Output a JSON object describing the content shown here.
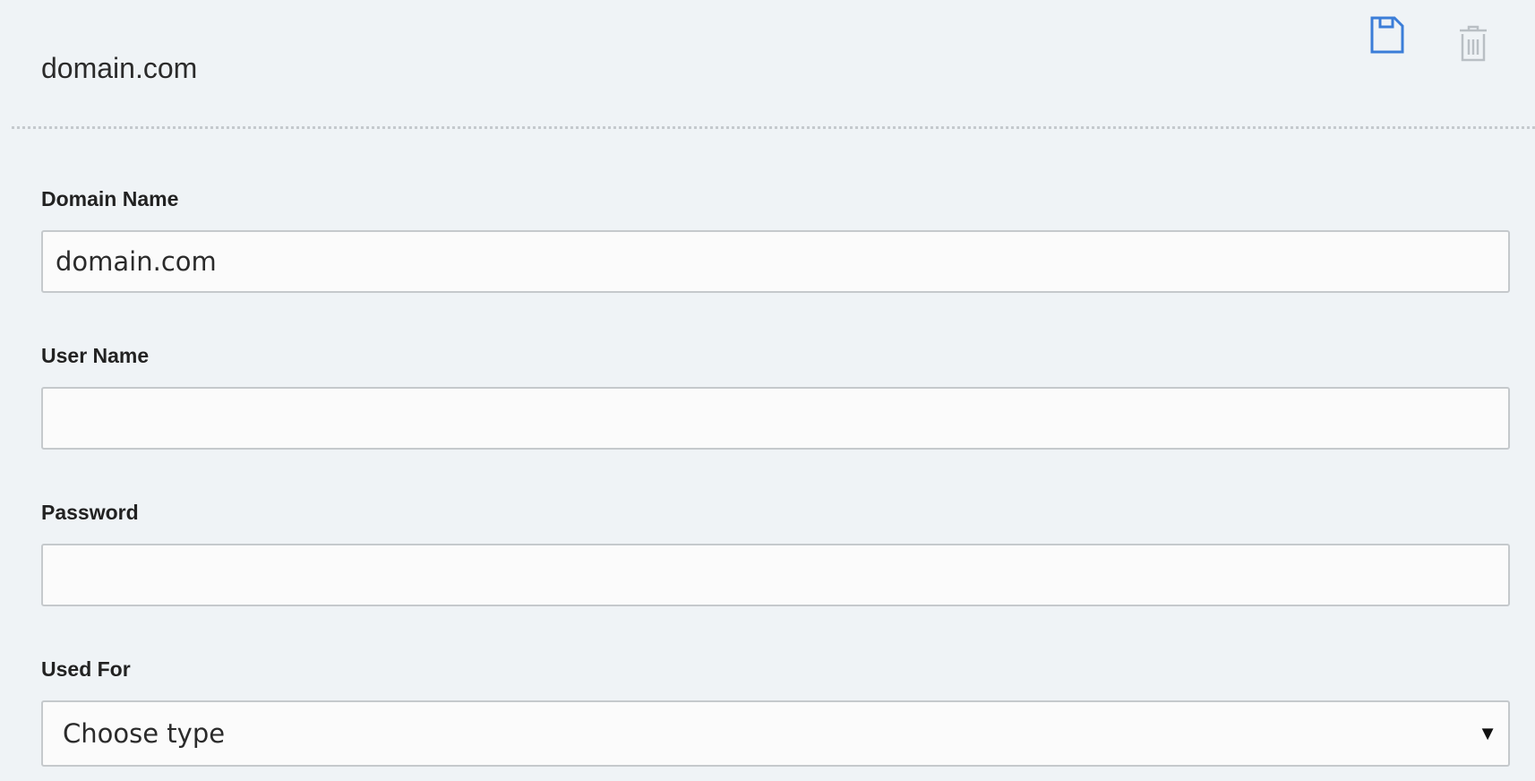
{
  "header": {
    "title": "domain.com"
  },
  "toolbar": {
    "save_icon": "floppy-disk-icon",
    "delete_icon": "trash-icon",
    "save_color": "#3b7dd8",
    "delete_color": "#b9bfc4"
  },
  "form": {
    "domain_name": {
      "label": "Domain Name",
      "value": "domain.com",
      "placeholder": ""
    },
    "user_name": {
      "label": "User Name",
      "value": "",
      "placeholder": ""
    },
    "password": {
      "label": "Password",
      "value": "",
      "placeholder": ""
    },
    "used_for": {
      "label": "Used For",
      "selected": "Choose type",
      "arrow_icon": "caret-down-icon"
    }
  }
}
